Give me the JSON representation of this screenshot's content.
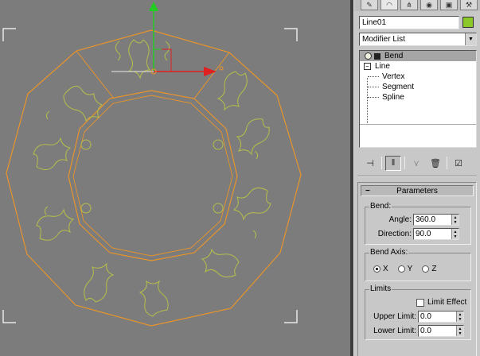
{
  "viewport": {
    "colors": {
      "background": "#7c7c7c",
      "wire": "#e8942a",
      "ornament": "#b6bf4a",
      "gizmo_y": "#22cc22",
      "gizmo_x": "#e02020",
      "bracket": "#e8e8e8"
    }
  },
  "panel": {
    "tabs": [
      {
        "icon": "create-icon",
        "glyph": "✎"
      },
      {
        "icon": "modify-icon",
        "glyph": "◠"
      },
      {
        "icon": "hierarchy-icon",
        "glyph": "⋔"
      },
      {
        "icon": "motion-icon",
        "glyph": "◉"
      },
      {
        "icon": "display-icon",
        "glyph": "▣"
      },
      {
        "icon": "utilities-icon",
        "glyph": "⚒"
      }
    ],
    "object_name": "Line01",
    "object_color": "#8cc82a",
    "modifier_list_label": "Modifier List",
    "stack": {
      "items": [
        {
          "label": "Bend",
          "selected": true
        },
        {
          "label": "Line",
          "selected": false
        }
      ],
      "subitems": [
        "Vertex",
        "Segment",
        "Spline"
      ]
    },
    "stack_buttons": [
      {
        "icon": "pin-stack-icon",
        "glyph": "⊣"
      },
      {
        "icon": "show-end-result-icon",
        "glyph": "‖"
      },
      {
        "icon": "make-unique-icon",
        "glyph": "⋎"
      },
      {
        "icon": "remove-modifier-icon",
        "glyph": "🗑"
      },
      {
        "icon": "configure-sets-icon",
        "glyph": "☑"
      }
    ],
    "parameters": {
      "title": "Parameters",
      "bend_group": "Bend:",
      "angle_label": "Angle:",
      "angle_value": "360.0",
      "direction_label": "Direction:",
      "direction_value": "90.0",
      "axis_group": "Bend Axis:",
      "axes": [
        {
          "label": "X",
          "selected": true
        },
        {
          "label": "Y",
          "selected": false
        },
        {
          "label": "Z",
          "selected": false
        }
      ],
      "limits_group": "Limits",
      "limit_effect_label": "Limit Effect",
      "limit_effect_checked": false,
      "upper_limit_label": "Upper Limit:",
      "upper_limit_value": "0.0",
      "lower_limit_label": "Lower Limit:",
      "lower_limit_value": "0.0"
    }
  }
}
